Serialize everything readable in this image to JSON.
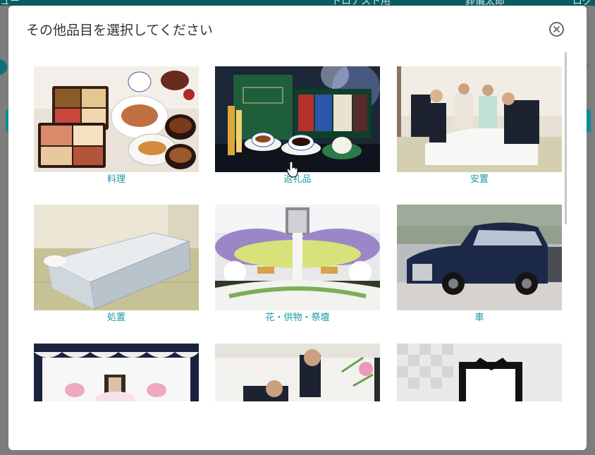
{
  "modal": {
    "title": "その他品目を選択してください",
    "close_icon": "close-circle-icon"
  },
  "background": {
    "header_fragments": [
      "ュー",
      "トロナスト用",
      "葬儀太郎",
      "ログ"
    ]
  },
  "items": [
    {
      "label": "料理",
      "image": "catering-food-photo"
    },
    {
      "label": "返礼品",
      "image": "gift-set-photo"
    },
    {
      "label": "安置",
      "image": "laying-out-body-photo"
    },
    {
      "label": "処置",
      "image": "dry-ice-bedding-photo"
    },
    {
      "label": "花・供物・祭壇",
      "image": "flower-altar-photo"
    },
    {
      "label": "車",
      "image": "hearse-car-photo"
    },
    {
      "label": "",
      "image": "funeral-hall-photo"
    },
    {
      "label": "",
      "image": "staff-arranging-flowers-photo"
    },
    {
      "label": "",
      "image": "memorial-frame-photo"
    }
  ],
  "colors": {
    "accent": "#1a9aa3",
    "header": "#0b5b63"
  }
}
